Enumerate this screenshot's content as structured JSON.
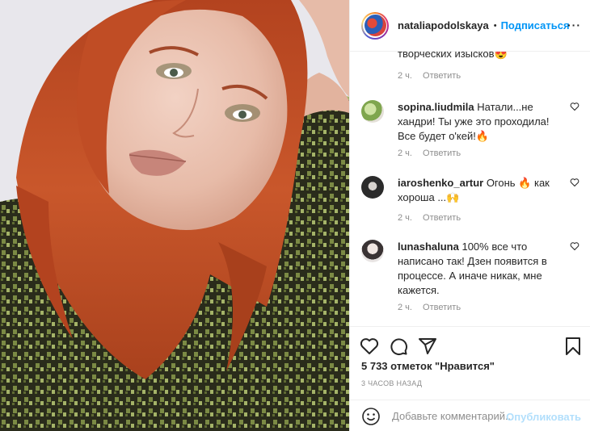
{
  "header": {
    "username": "nataliapodolskaya",
    "separator": "•",
    "follow_label": "Подписаться",
    "more_label": "···"
  },
  "comments": [
    {
      "user": "",
      "text": "творческих изысков",
      "emoji": "😍",
      "time": "2 ч.",
      "reply": "Ответить"
    },
    {
      "user": "sopina.liudmila",
      "text": " Натали...не хандри! Ты уже это проходила! Все будет о'кей!",
      "emoji": "🔥",
      "time": "2 ч.",
      "reply": "Ответить"
    },
    {
      "user": "iaroshenko_artur",
      "text": " Огонь 🔥 как хороша ...",
      "emoji": "🙌",
      "time": "2 ч.",
      "reply": "Ответить"
    },
    {
      "user": "lunashaluna",
      "text": " 100% все что написано так! Дзен появится в процессе. А иначе никак, мне кажется.",
      "emoji": "",
      "time": "2 ч.",
      "reply": "Ответить"
    }
  ],
  "actions": {
    "likes": "5 733 отметок \"Нравится\"",
    "time_ago": "3 ЧАСОВ НАЗАД"
  },
  "add_comment": {
    "placeholder": "Добавьте комментарий...",
    "publish_label": "Опубликовать"
  },
  "icons": [
    "heart-icon",
    "comment-icon",
    "share-icon",
    "bookmark-icon",
    "emoji-icon",
    "more-icon"
  ],
  "colors": {
    "accent": "#0095f6",
    "publish_disabled": "#b2dffc",
    "muted": "#8e8e8e",
    "hair": "#c4532a",
    "sequin": "#6f7d3a"
  }
}
